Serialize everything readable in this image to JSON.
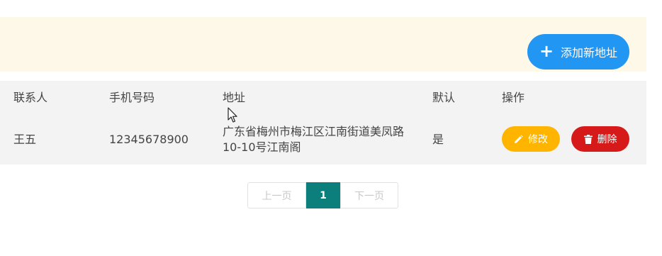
{
  "toolbar": {
    "add_label": "添加新地址",
    "accent": "#2196f3"
  },
  "table": {
    "columns": [
      "联系人",
      "手机号码",
      "地址",
      "默认",
      "操作"
    ],
    "rows": [
      {
        "name": "王五",
        "phone": "12345678900",
        "address": "广东省梅州市梅江区江南街道美凤路10-10号江南阁",
        "default": "是",
        "edit_label": "修改",
        "delete_label": "删除"
      }
    ]
  },
  "pagination": {
    "prev": "上一页",
    "current": "1",
    "next": "下一页"
  },
  "colors": {
    "edit": "#ffb400",
    "delete": "#d61a1a",
    "page_active": "#0c7f7d",
    "banner_bg": "#fdf8e8"
  }
}
